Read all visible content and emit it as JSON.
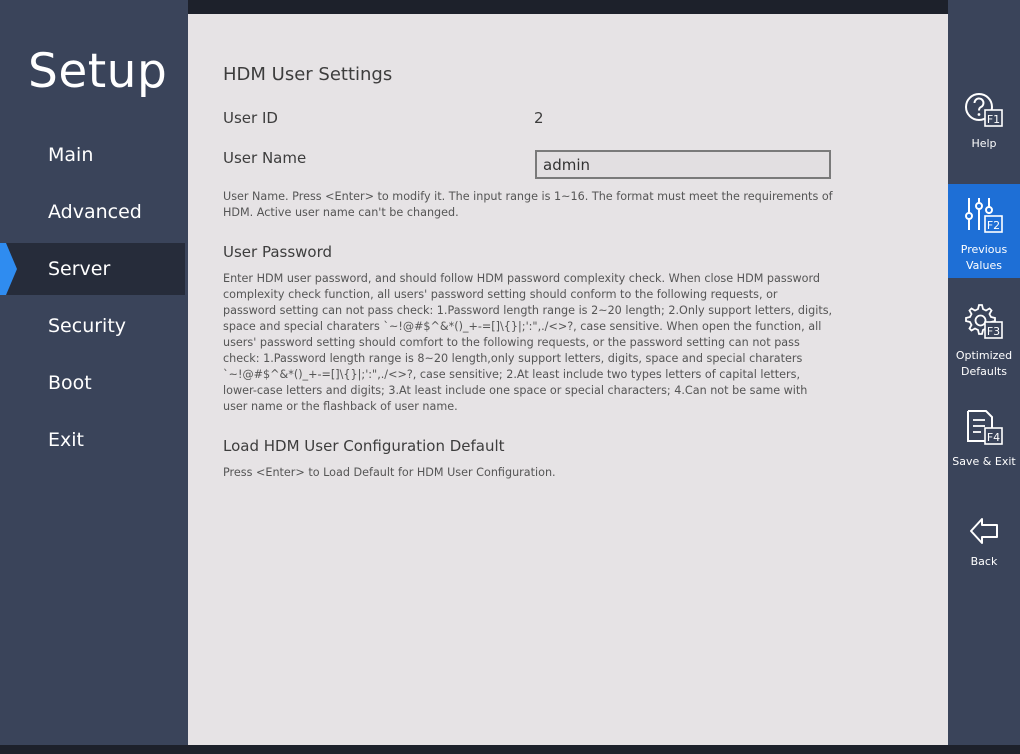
{
  "sidebar": {
    "title": "Setup",
    "items": [
      {
        "label": "Main"
      },
      {
        "label": "Advanced"
      },
      {
        "label": "Server"
      },
      {
        "label": "Security"
      },
      {
        "label": "Boot"
      },
      {
        "label": "Exit"
      }
    ],
    "active_index": 2
  },
  "main": {
    "title": "HDM User Settings",
    "user_id": {
      "label": "User ID",
      "value": "2"
    },
    "user_name": {
      "label": "User Name",
      "value": "admin",
      "description": "User Name. Press <Enter> to modify it. The input range is 1~16. The format must meet the requirements of HDM. Active user name can't be changed."
    },
    "user_password": {
      "label": "User Password",
      "description": "Enter HDM user password, and should follow HDM password complexity check. When close HDM password complexity check function, all users' password setting should conform to the following requests, or password setting can not pass check: 1.Password length range is 2~20 length; 2.Only support letters, digits, space and special charaters `~!@#$^&*()_+-=[]\\{}|;':\",./<>?, case sensitive. When open the function, all users' password setting should comfort to the following requests, or the password setting can not pass check: 1.Password length range is 8~20 length,only support letters, digits, space and special charaters `~!@#$^&*()_+-=[]\\{}|;':\",./<>?, case sensitive; 2.At least include two types letters of capital letters, lower-case letters and digits; 3.At least include one space or special characters; 4.Can not be same with user name or the flashback of user name."
    },
    "load_default": {
      "label": "Load HDM User Configuration Default",
      "description": "Press <Enter> to Load Default for HDM User Configuration."
    }
  },
  "toolbar": {
    "items": [
      {
        "label": "Help",
        "key": "F1",
        "icon": "help-icon"
      },
      {
        "label": "Previous Values",
        "key": "F2",
        "icon": "sliders-icon"
      },
      {
        "label": "Optimized Defaults",
        "key": "F3",
        "icon": "gear-icon"
      },
      {
        "label": "Save & Exit",
        "key": "F4",
        "icon": "save-document-icon"
      },
      {
        "label": "Back",
        "icon": "back-arrow-icon"
      }
    ],
    "active_index": 1
  },
  "colors": {
    "sidebar_bg": "#3a445a",
    "active_nav_bg": "#262c3a",
    "active_tool_bg": "#1e6fd6",
    "content_bg": "#e6e3e5",
    "accent_arrow": "#2f8cf0"
  }
}
